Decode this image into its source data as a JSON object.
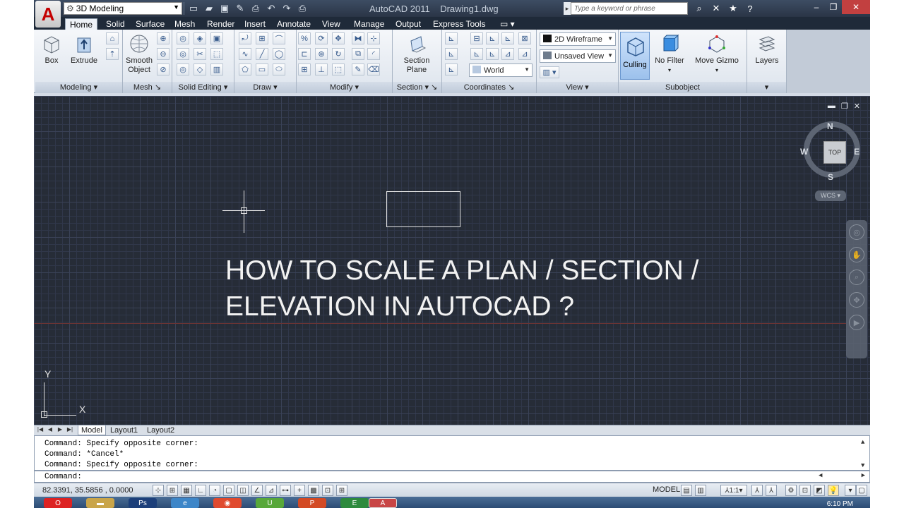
{
  "title_bar": {
    "logo_letter": "A",
    "workspace": "3D Modeling",
    "app_title": "AutoCAD 2011    Drawing1.dwg",
    "search_placeholder": "Type a keyword or phrase",
    "help_icon": "?"
  },
  "tabs": [
    "Home",
    "Solid",
    "Surface",
    "Mesh",
    "Render",
    "Insert",
    "Annotate",
    "View",
    "Manage",
    "Output",
    "Express Tools"
  ],
  "active_tab": "Home",
  "ribbon": {
    "modeling": {
      "title": "Modeling",
      "box": "Box",
      "extrude": "Extrude"
    },
    "mesh": {
      "title": "Mesh",
      "smooth_line1": "Smooth",
      "smooth_line2": "Object"
    },
    "solid_editing": {
      "title": "Solid Editing"
    },
    "draw": {
      "title": "Draw"
    },
    "modify": {
      "title": "Modify"
    },
    "section": {
      "title": "Section",
      "line1": "Section",
      "line2": "Plane"
    },
    "coordinates": {
      "title": "Coordinates",
      "ucs": "World"
    },
    "view": {
      "title": "View",
      "visual_style": "2D Wireframe",
      "named_view": "Unsaved View"
    },
    "subobject": {
      "title": "Subobject",
      "culling": "Culling",
      "no_filter": "No Filter",
      "move_gizmo": "Move Gizmo"
    },
    "layers": {
      "label": "Layers"
    }
  },
  "viewport": {
    "heading_line1": "HOW TO SCALE A PLAN / SECTION /",
    "heading_line2": "ELEVATION IN AUTOCAD ?",
    "compass": {
      "n": "N",
      "s": "S",
      "e": "E",
      "w": "W"
    },
    "cube_face": "TOP",
    "wcs": "WCS",
    "ucs_x": "X",
    "ucs_y": "Y"
  },
  "layout_tabs": [
    "Model",
    "Layout1",
    "Layout2"
  ],
  "command_history": [
    "Command: Specify opposite corner:",
    "Command: *Cancel*",
    "Command: Specify opposite corner:"
  ],
  "command_prompt": "Command:",
  "status": {
    "coordinates": "82.3391, 35.5856 , 0.0000",
    "model": "MODEL",
    "scale": "1:1"
  },
  "taskbar": {
    "clock": "6:10 PM"
  },
  "colors": {
    "viewport_bg": "#262c37",
    "accent": "#c40000"
  }
}
